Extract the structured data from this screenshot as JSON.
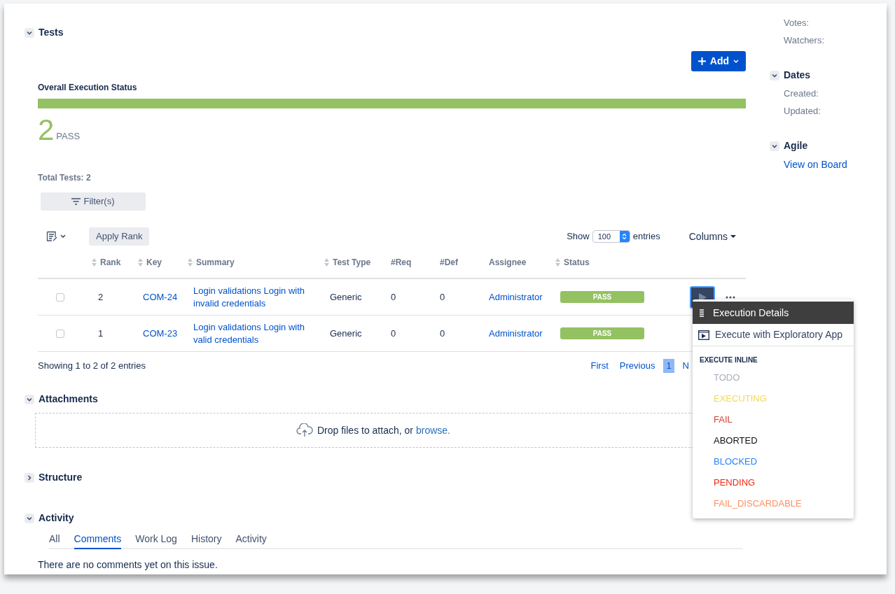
{
  "tests": {
    "title": "Tests",
    "expanded": true,
    "add_button": "Add",
    "overall": {
      "label": "Overall Execution Status",
      "level": 1
    },
    "count": "2",
    "count_label": "PASS",
    "total": "Total Tests: 2",
    "filter_button": "Filter(s)",
    "apply_rank": "Apply Rank",
    "show_label": "Show",
    "show_value": "100",
    "entries_label": "entries",
    "columns_button": "Columns",
    "columns": [
      {
        "label": "Rank",
        "sortable": true
      },
      {
        "label": "Key",
        "sortable": true
      },
      {
        "label": "Summary",
        "sortable": true
      },
      {
        "label": "Test Type",
        "sortable": true
      },
      {
        "label": "#Req",
        "sortable": false
      },
      {
        "label": "#Def",
        "sortable": false
      },
      {
        "label": "Assignee",
        "sortable": false
      },
      {
        "label": "Status",
        "sortable": true
      }
    ],
    "rows": [
      {
        "checked": false,
        "rank": "2",
        "key": "COM-24",
        "summary": "Login validations Login with invalid credentials",
        "type": "Generic",
        "req": "0",
        "def": "0",
        "assignee": "Administrator",
        "status": "PASS",
        "color": "#94c162",
        "active": true
      },
      {
        "checked": false,
        "rank": "1",
        "key": "COM-23",
        "summary": "Login validations Login with valid credentials",
        "type": "Generic",
        "req": "0",
        "def": "0",
        "assignee": "Administrator",
        "status": "PASS",
        "color": "#94c162",
        "active": false
      }
    ],
    "showing": "Showing 1 to 2 of 2 entries",
    "pagination": [
      {
        "label": "First",
        "selected": false
      },
      {
        "label": "Previous",
        "selected": false
      },
      {
        "label": "1",
        "selected": true
      },
      {
        "label": "N",
        "selected": false
      }
    ]
  },
  "menu": {
    "items": [
      {
        "label": "Execution Details",
        "selected": true,
        "kind": "details"
      },
      {
        "label": "Execute with Exploratory App",
        "selected": false,
        "kind": "app"
      }
    ],
    "section": "EXECUTE INLINE",
    "statuses": [
      {
        "label": "TODO",
        "color": "#a5adba"
      },
      {
        "label": "EXECUTING",
        "color": "#f1d958"
      },
      {
        "label": "FAIL",
        "color": "#d04437"
      },
      {
        "label": "ABORTED",
        "color": "#111111"
      },
      {
        "label": "BLOCKED",
        "color": "#2684ff"
      },
      {
        "label": "PENDING",
        "color": "#f2260f"
      },
      {
        "label": "FAIL_DISCARDABLE",
        "color": "#ff8f5e"
      }
    ]
  },
  "attachments": {
    "title": "Attachments",
    "expanded": true,
    "drop_text": "Drop files to attach, or",
    "browse": "browse."
  },
  "structure": {
    "title": "Structure",
    "expanded": false
  },
  "activity": {
    "title": "Activity",
    "expanded": true,
    "tabs": [
      {
        "label": "All",
        "selected": false
      },
      {
        "label": "Comments",
        "selected": true
      },
      {
        "label": "Work Log",
        "selected": false
      },
      {
        "label": "History",
        "selected": false
      },
      {
        "label": "Activity",
        "selected": false
      }
    ],
    "empty": "There are no comments yet on this issue."
  },
  "sidebar": {
    "people_fields": [
      "Votes:",
      "Watchers:"
    ],
    "dates": {
      "title": "Dates",
      "expanded": true,
      "fields": [
        "Created:",
        "Updated:"
      ]
    },
    "agile": {
      "title": "Agile",
      "expanded": true,
      "link": "View on Board"
    }
  }
}
